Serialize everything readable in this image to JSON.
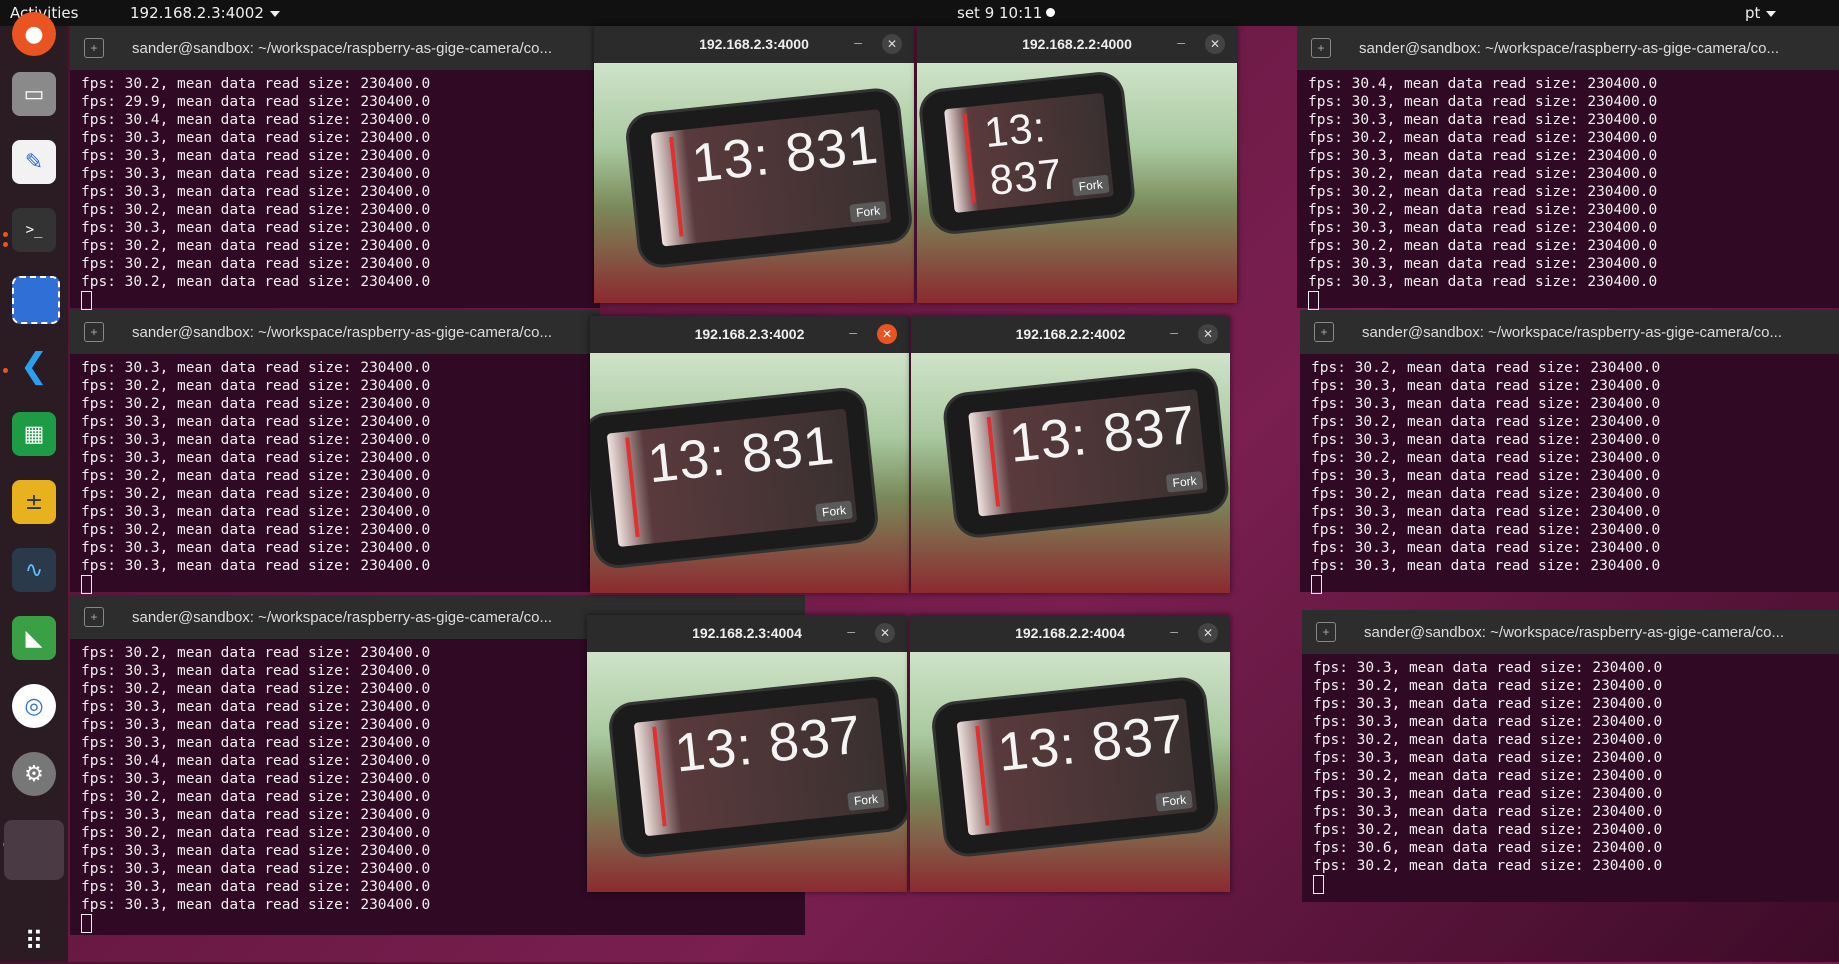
{
  "topbar": {
    "activities": "Activities",
    "app_menu": "192.168.2.3:4002",
    "clock": "set 9  10:11",
    "lang": "pt"
  },
  "dock": [
    "ubuntu-software-icon",
    "files-icon",
    "text-editor-icon",
    "terminal-icon",
    "screenshot-icon",
    "vscode-icon",
    "spreadsheet-icon",
    "calculator-icon",
    "system-monitor-icon",
    "geometry-icon",
    "chromium-icon",
    "settings-icon",
    "app-active-icon",
    "show-apps-icon"
  ],
  "terminal_title_left": "sander@sandbox: ~/workspace/raspberry-as-gige-camera/co...",
  "terminal_title_right": "sander@sandbox: ~/workspace/raspberry-as-gige-camera/co...",
  "terminals": {
    "tl": [
      "fps: 30.2, mean data read size: 230400.0",
      "fps: 29.9, mean data read size: 230400.0",
      "fps: 30.4, mean data read size: 230400.0",
      "fps: 30.3, mean data read size: 230400.0",
      "fps: 30.3, mean data read size: 230400.0",
      "fps: 30.3, mean data read size: 230400.0",
      "fps: 30.3, mean data read size: 230400.0",
      "fps: 30.2, mean data read size: 230400.0",
      "fps: 30.3, mean data read size: 230400.0",
      "fps: 30.2, mean data read size: 230400.0",
      "fps: 30.2, mean data read size: 230400.0",
      "fps: 30.2, mean data read size: 230400.0"
    ],
    "ml": [
      "fps: 30.3, mean data read size: 230400.0",
      "fps: 30.2, mean data read size: 230400.0",
      "fps: 30.2, mean data read size: 230400.0",
      "fps: 30.3, mean data read size: 230400.0",
      "fps: 30.3, mean data read size: 230400.0",
      "fps: 30.3, mean data read size: 230400.0",
      "fps: 30.2, mean data read size: 230400.0",
      "fps: 30.2, mean data read size: 230400.0",
      "fps: 30.3, mean data read size: 230400.0",
      "fps: 30.2, mean data read size: 230400.0",
      "fps: 30.3, mean data read size: 230400.0",
      "fps: 30.3, mean data read size: 230400.0"
    ],
    "bl": [
      "fps: 30.2, mean data read size: 230400.0",
      "fps: 30.3, mean data read size: 230400.0",
      "fps: 30.2, mean data read size: 230400.0",
      "fps: 30.3, mean data read size: 230400.0",
      "fps: 30.3, mean data read size: 230400.0",
      "fps: 30.3, mean data read size: 230400.0",
      "fps: 30.4, mean data read size: 230400.0",
      "fps: 30.3, mean data read size: 230400.0",
      "fps: 30.2, mean data read size: 230400.0",
      "fps: 30.3, mean data read size: 230400.0",
      "fps: 30.2, mean data read size: 230400.0",
      "fps: 30.3, mean data read size: 230400.0",
      "fps: 30.3, mean data read size: 230400.0",
      "fps: 30.3, mean data read size: 230400.0",
      "fps: 30.3, mean data read size: 230400.0"
    ],
    "tr": [
      "fps: 30.4, mean data read size: 230400.0",
      "fps: 30.3, mean data read size: 230400.0",
      "fps: 30.3, mean data read size: 230400.0",
      "fps: 30.2, mean data read size: 230400.0",
      "fps: 30.3, mean data read size: 230400.0",
      "fps: 30.2, mean data read size: 230400.0",
      "fps: 30.2, mean data read size: 230400.0",
      "fps: 30.2, mean data read size: 230400.0",
      "fps: 30.3, mean data read size: 230400.0",
      "fps: 30.2, mean data read size: 230400.0",
      "fps: 30.3, mean data read size: 230400.0",
      "fps: 30.3, mean data read size: 230400.0"
    ],
    "mr": [
      "fps: 30.2, mean data read size: 230400.0",
      "fps: 30.3, mean data read size: 230400.0",
      "fps: 30.3, mean data read size: 230400.0",
      "fps: 30.2, mean data read size: 230400.0",
      "fps: 30.3, mean data read size: 230400.0",
      "fps: 30.2, mean data read size: 230400.0",
      "fps: 30.3, mean data read size: 230400.0",
      "fps: 30.2, mean data read size: 230400.0",
      "fps: 30.3, mean data read size: 230400.0",
      "fps: 30.2, mean data read size: 230400.0",
      "fps: 30.3, mean data read size: 230400.0",
      "fps: 30.3, mean data read size: 230400.0"
    ],
    "br": [
      "fps: 30.3, mean data read size: 230400.0",
      "fps: 30.2, mean data read size: 230400.0",
      "fps: 30.3, mean data read size: 230400.0",
      "fps: 30.3, mean data read size: 230400.0",
      "fps: 30.2, mean data read size: 230400.0",
      "fps: 30.3, mean data read size: 230400.0",
      "fps: 30.2, mean data read size: 230400.0",
      "fps: 30.3, mean data read size: 230400.0",
      "fps: 30.3, mean data read size: 230400.0",
      "fps: 30.2, mean data read size: 230400.0",
      "fps: 30.6, mean data read size: 230400.0",
      "fps: 30.2, mean data read size: 230400.0"
    ]
  },
  "camera_windows": [
    {
      "title": "192.168.2.3:4000",
      "clock": "13: 831",
      "fork": "Fork"
    },
    {
      "title": "192.168.2.2:4000",
      "clock": "13: 837",
      "fork": "Fork"
    },
    {
      "title": "192.168.2.3:4002",
      "clock": "13: 831",
      "fork": "Fork"
    },
    {
      "title": "192.168.2.2:4002",
      "clock": "13: 837",
      "fork": "Fork"
    },
    {
      "title": "192.168.2.3:4004",
      "clock": "13: 837",
      "fork": "Fork"
    },
    {
      "title": "192.168.2.2:4004",
      "clock": "13: 837",
      "fork": "Fork"
    }
  ]
}
